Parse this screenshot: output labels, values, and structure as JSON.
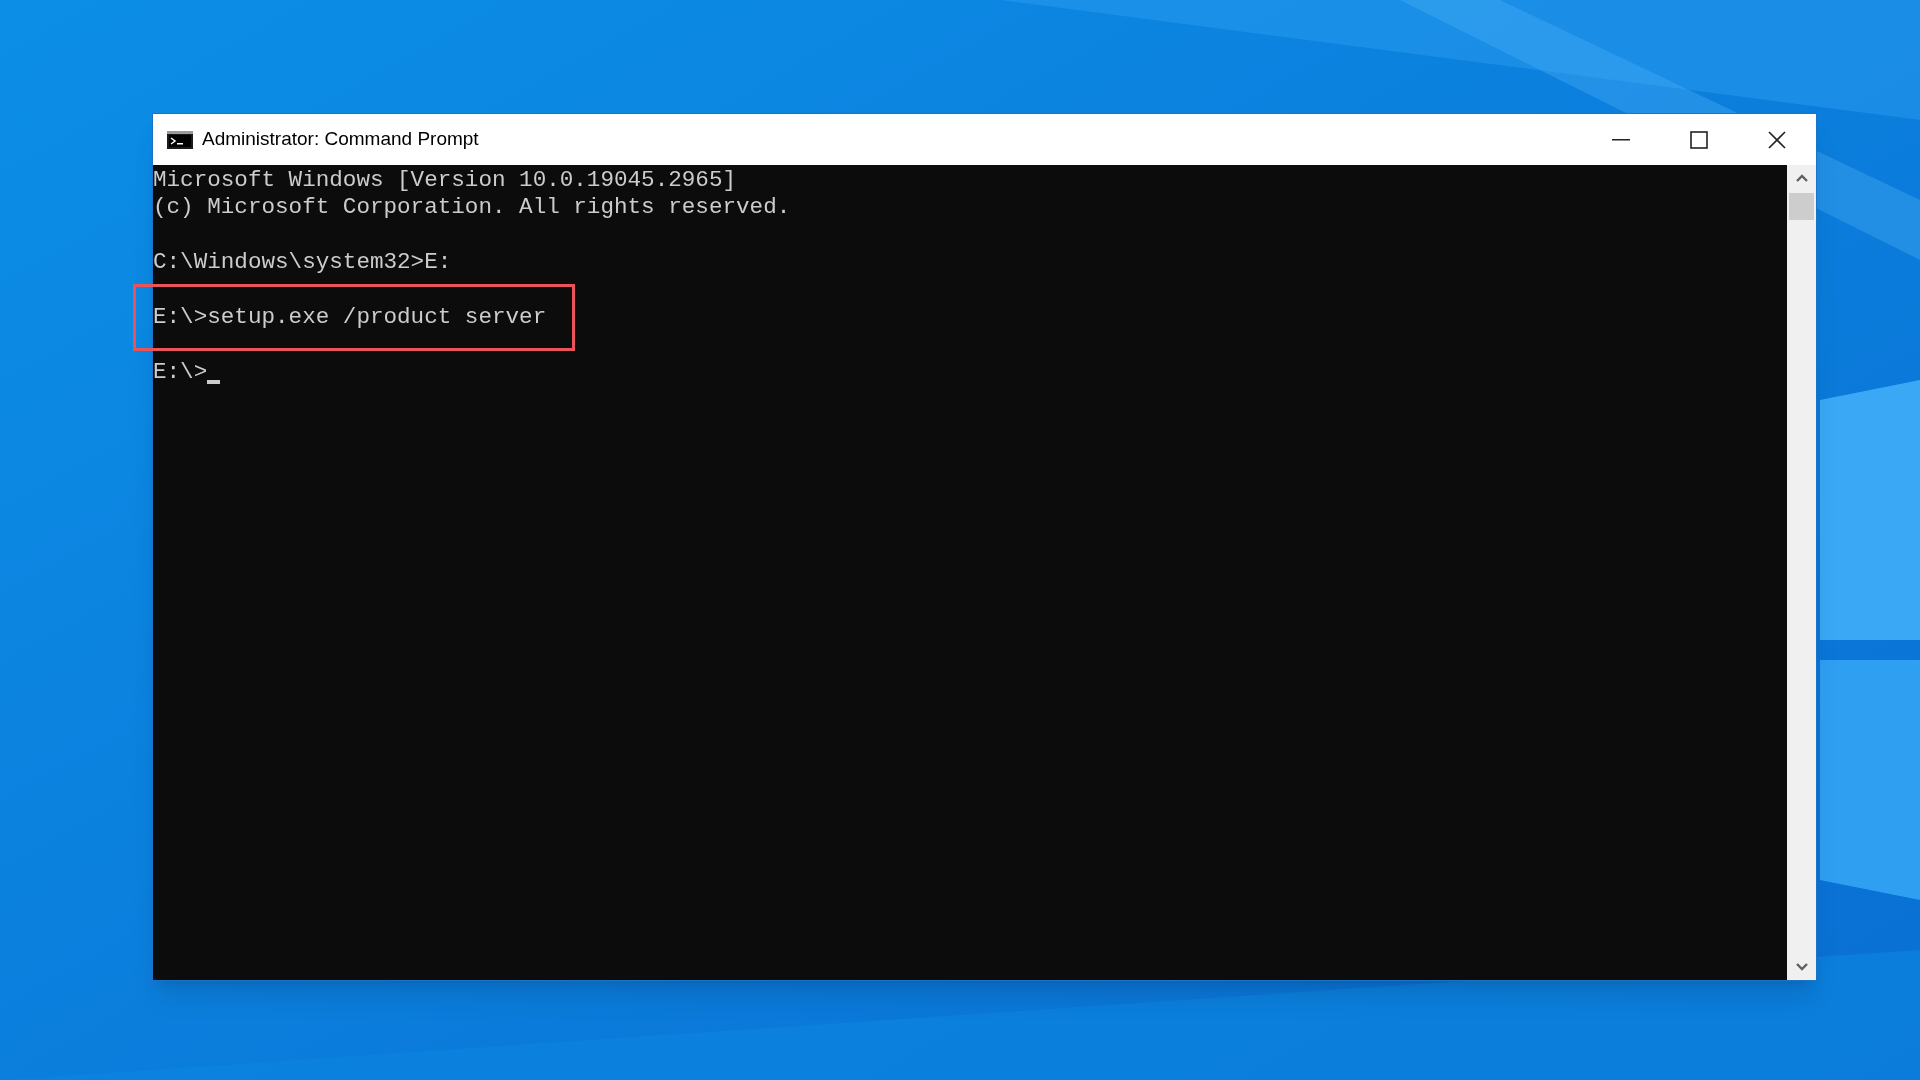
{
  "window": {
    "title": "Administrator: Command Prompt"
  },
  "console": {
    "blocks": [
      {
        "lines": [
          "Microsoft Windows [Version 10.0.19045.2965]",
          "(c) Microsoft Corporation. All rights reserved."
        ],
        "highlighted": false,
        "cursor": false
      },
      {
        "lines": [
          "C:\\Windows\\system32>E:"
        ],
        "highlighted": false,
        "cursor": false
      },
      {
        "lines": [
          "E:\\>setup.exe /product server"
        ],
        "highlighted": true,
        "cursor": false
      },
      {
        "lines": [
          "E:\\>"
        ],
        "highlighted": false,
        "cursor": true
      }
    ]
  }
}
